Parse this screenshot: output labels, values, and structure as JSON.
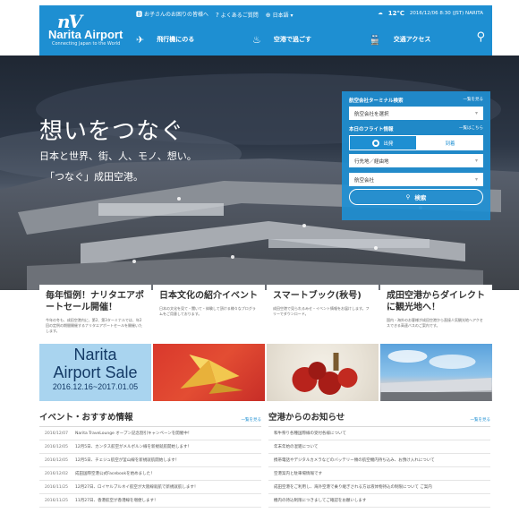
{
  "header": {
    "logo_name": "Narita Airport",
    "logo_tagline": "Connecting Japan to the World",
    "utility": [
      {
        "icon": "info-icon",
        "label": "お子さんのお困りの皆様へ"
      },
      {
        "icon": "question-icon",
        "label": "よくあるご質問"
      },
      {
        "icon": "globe-icon",
        "label": "日本語"
      }
    ],
    "weather": {
      "temp": "12℃",
      "datetime": "2016/12/06 8:30 (JST) NARITA"
    },
    "nav": [
      {
        "icon": "airplane-icon",
        "label": "飛行機にのる"
      },
      {
        "icon": "shopping-icon",
        "label": "空港で過ごす"
      },
      {
        "icon": "train-icon",
        "label": "交通アクセス"
      }
    ]
  },
  "hero": {
    "title": "想いをつなぐ",
    "subtitle": "日本と世界、街、人、モノ、想い。",
    "subtitle2": "「つなぐ」成田空港。"
  },
  "flight_panel": {
    "airline_heading": "航空会社ターミナル検索",
    "airline_more": "一覧を見る",
    "airline_select": "航空会社を選択",
    "flight_heading": "本日のフライト情報",
    "flight_more": "一覧はこちら",
    "departure": "出発",
    "arrival": "到着",
    "destination_select": "行先地／経由地",
    "carrier_select": "航空会社",
    "search_button": "検索"
  },
  "cards": [
    {
      "title": "毎年恒例！ナリタエアポートセール開催！",
      "body": "今年の冬も、成田空港内に、第2、第3ターミナルでは、年2回の定例の期間開催するナリタエアポートセールを開催いたします。"
    },
    {
      "title": "日本文化の紹介イベント",
      "body": "日本の文化を見て・聞いて・体験して頂ける様々なプログラムをご用意しております。"
    },
    {
      "title": "スマートブック(秋号)",
      "body": "成田空港で見られるみせ・イベント情報をお届けします。フリーでダウンロード。"
    },
    {
      "title": "成田空港からダイレクトに観光地へ！",
      "body": "国内・海外のお客様が成田空港から直接人気観光地へアクセスできる高速バスのご案内です。"
    }
  ],
  "tiles": {
    "sale_line1": "Narita",
    "sale_line2": "Airport Sale",
    "sale_dates": "2016.12.16~2017.01.05"
  },
  "news_left": {
    "title": "イベント・おすすめ情報",
    "more": "一覧を見る",
    "items": [
      {
        "date": "2016/12/07",
        "text": "Narita TraveLounge オープン記念割引キャンペーンを開催中！"
      },
      {
        "date": "2016/12/05",
        "text": "12月5日、カンタス航空がメルボルン線を新規就航開始します！"
      },
      {
        "date": "2016/12/05",
        "text": "12月5日、チェジュ航空が釜山線を新規就航開始します！"
      },
      {
        "date": "2016/12/02",
        "text": "成田国際空港公式Facebookを始めました！"
      },
      {
        "date": "2016/11/25",
        "text": "12月27日、ロイヤルブルネイ航空が大阪線就航で新規就航します！"
      },
      {
        "date": "2016/11/25",
        "text": "11月27日、香港航空が香港線を増便します！"
      }
    ]
  },
  "news_right": {
    "title": "空港からのお知らせ",
    "more": "一覧を見る",
    "items": [
      {
        "text": "和牛祭り各種国際線の受付各様について"
      },
      {
        "text": "年末年始の混雑について"
      },
      {
        "text": "携帯電話やデジタルカメラなどのバッテリー類の航空機内持ち込み、お預け入れについて"
      },
      {
        "text": "空港案内と駐車場情報です"
      },
      {
        "text": "成田空港をご利用し、海外空港で乗り継ぎされる方は液体物持込の制限について ご案内"
      },
      {
        "text": "機内の持込制限につきましてご確認をお願いします"
      }
    ]
  },
  "colors": {
    "brand": "#1e8fd2"
  }
}
